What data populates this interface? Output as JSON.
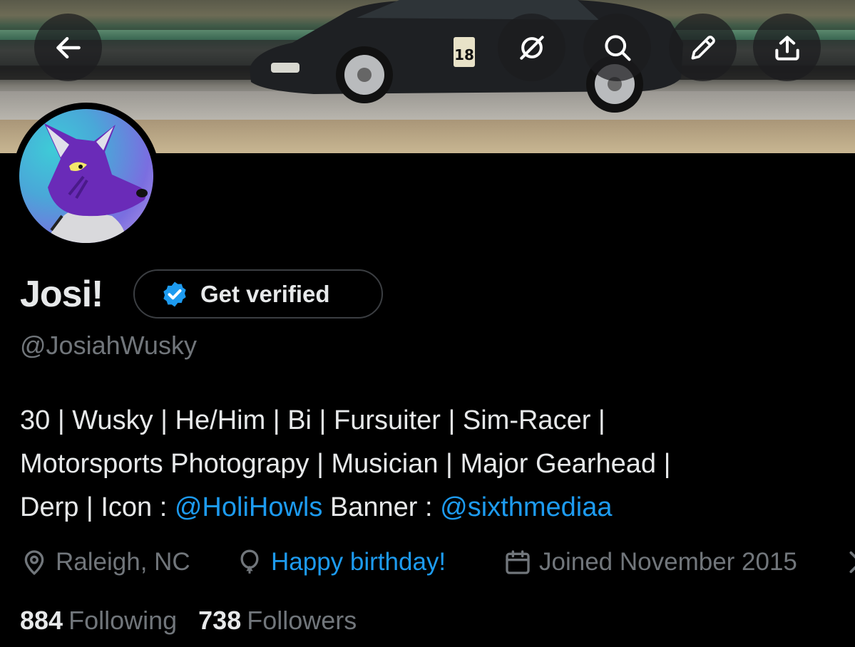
{
  "header": {
    "back_icon": "arrow-left-icon",
    "actions": [
      "eye-off-icon",
      "search-icon",
      "edit-pencil-icon",
      "share-upload-icon"
    ],
    "banner_car_number": "18"
  },
  "profile": {
    "name": "Josi!",
    "get_verified_label": "Get verified",
    "verified_badge_color": "#1d9bf0",
    "handle": "@JosiahWusky",
    "bio": {
      "line1": "30 | Wusky | He/Him | Bi | Fursuiter | Sim-Racer |",
      "line2": "Motorsports Photograpy | Musician | Major Gearhead |",
      "line3_prefix": "Derp | Icon : ",
      "icon_credit": "@HoliHowls",
      "banner_label": " Banner : ",
      "banner_credit": "@sixthmediaa"
    },
    "location": "Raleigh, NC",
    "birthday": "Happy birthday!",
    "joined": "Joined November 2015",
    "following_count": "884",
    "following_label": "Following",
    "followers_count": "738",
    "followers_label": "Followers"
  },
  "colors": {
    "background": "#000000",
    "text_primary": "#e7e9ea",
    "text_secondary": "#71767b",
    "accent": "#1d9bf0"
  }
}
